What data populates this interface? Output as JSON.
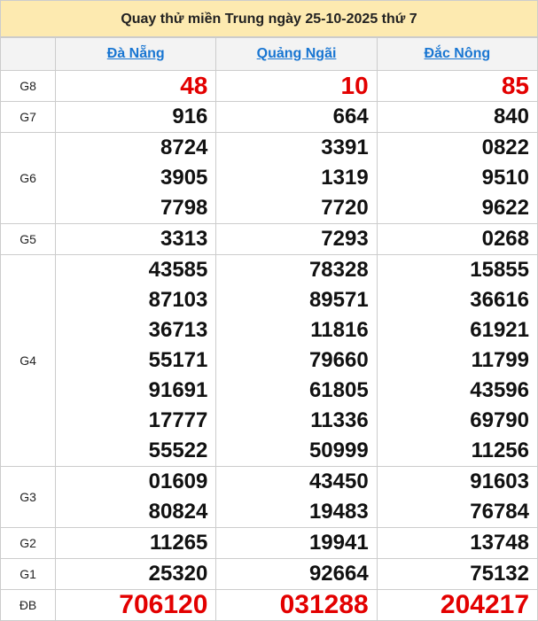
{
  "header": {
    "title": "Quay thử miền Trung ngày 25-10-2025 thứ 7"
  },
  "provinces": [
    "Đà Nẵng",
    "Quảng Ngãi",
    "Đắc Nông"
  ],
  "prizes": {
    "g8": {
      "label": "G8",
      "values": [
        [
          "48"
        ],
        [
          "10"
        ],
        [
          "85"
        ]
      ]
    },
    "g7": {
      "label": "G7",
      "values": [
        [
          "916"
        ],
        [
          "664"
        ],
        [
          "840"
        ]
      ]
    },
    "g6": {
      "label": "G6",
      "values": [
        [
          "8724",
          "3905",
          "7798"
        ],
        [
          "3391",
          "1319",
          "7720"
        ],
        [
          "0822",
          "9510",
          "9622"
        ]
      ]
    },
    "g5": {
      "label": "G5",
      "values": [
        [
          "3313"
        ],
        [
          "7293"
        ],
        [
          "0268"
        ]
      ]
    },
    "g4": {
      "label": "G4",
      "values": [
        [
          "43585",
          "87103",
          "36713",
          "55171",
          "91691",
          "17777",
          "55522"
        ],
        [
          "78328",
          "89571",
          "11816",
          "79660",
          "61805",
          "11336",
          "50999"
        ],
        [
          "15855",
          "36616",
          "61921",
          "11799",
          "43596",
          "69790",
          "11256"
        ]
      ]
    },
    "g3": {
      "label": "G3",
      "values": [
        [
          "01609",
          "80824"
        ],
        [
          "43450",
          "19483"
        ],
        [
          "91603",
          "76784"
        ]
      ]
    },
    "g2": {
      "label": "G2",
      "values": [
        [
          "11265"
        ],
        [
          "19941"
        ],
        [
          "13748"
        ]
      ]
    },
    "g1": {
      "label": "G1",
      "values": [
        [
          "25320"
        ],
        [
          "92664"
        ],
        [
          "75132"
        ]
      ]
    },
    "db": {
      "label": "ĐB",
      "values": [
        [
          "706120"
        ],
        [
          "031288"
        ],
        [
          "204217"
        ]
      ]
    }
  },
  "colors": {
    "header_bg": "#fdeab0",
    "link": "#1976d2",
    "highlight": "#e30000",
    "border": "#cccccc"
  }
}
